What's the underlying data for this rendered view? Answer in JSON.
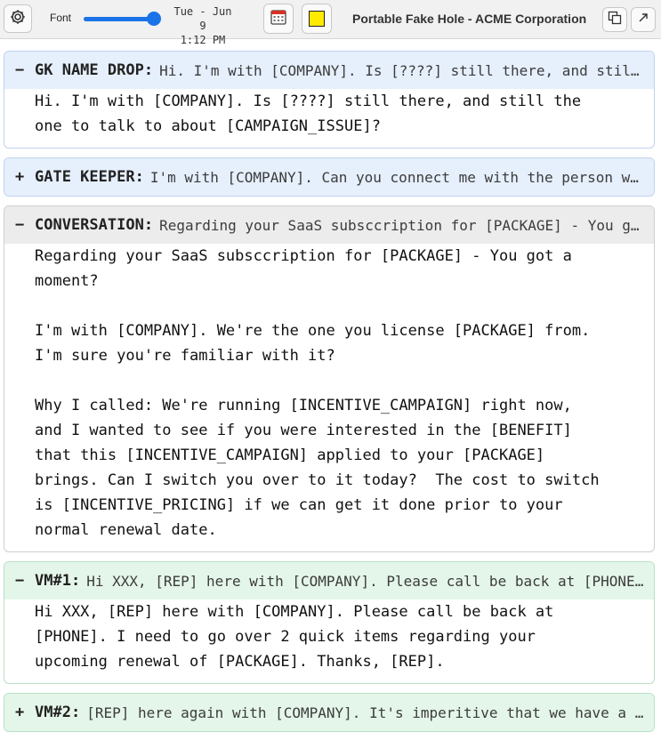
{
  "toolbar": {
    "font_label": "Font",
    "font_size_level": 0.92,
    "date": "Tue - Jun 9",
    "time": "1:12 PM",
    "highlight_color": "#ffea00",
    "title": "Portable Fake Hole - ACME Corporation",
    "icons": {
      "settings": "gear-icon",
      "calendar": "calendar-icon",
      "color": "color-swatch-icon",
      "copy": "copy-icon",
      "popout": "popout-arrow-icon"
    }
  },
  "colors": {
    "accent": "#1a73e8",
    "blue_card": "#e6effc",
    "gray_card": "#ececec",
    "green_card": "#e4f6e9"
  },
  "cards": [
    {
      "toggle": "−",
      "label": "GK NAME DROP:",
      "preview": "Hi. I'm with [COMPANY]. Is [????] still there, and still the one to talk to about [CAMPAIGN_ISSUE]?",
      "expanded": true,
      "body": "Hi. I'm with [COMPANY]. Is [????] still there, and still the\none to talk to about [CAMPAIGN_ISSUE]?"
    },
    {
      "toggle": "+",
      "label": "GATE KEEPER:",
      "preview": "I'm with [COMPANY]. Can you connect me with the person who handles [PACKAGE]?",
      "expanded": false,
      "body": ""
    },
    {
      "toggle": "−",
      "label": "CONVERSATION:",
      "preview": "Regarding your SaaS subsccription for [PACKAGE] - You got a moment?",
      "expanded": true,
      "body": "Regarding your SaaS subsccription for [PACKAGE] - You got a\nmoment?\n\nI'm with [COMPANY]. We're the one you license [PACKAGE] from.\nI'm sure you're familiar with it?\n\nWhy I called: We're running [INCENTIVE_CAMPAIGN] right now,\nand I wanted to see if you were interested in the [BENEFIT]\nthat this [INCENTIVE_CAMPAIGN] applied to your [PACKAGE]\nbrings. Can I switch you over to it today?  The cost to switch\nis [INCENTIVE_PRICING] if we can get it done prior to your\nnormal renewal date."
    },
    {
      "toggle": "−",
      "label": "VM#1:",
      "preview": "Hi XXX, [REP] here with [COMPANY]. Please call be back at [PHONE].",
      "expanded": true,
      "body": "Hi XXX, [REP] here with [COMPANY]. Please call be back at\n[PHONE]. I need to go over 2 quick items regarding your\nupcoming renewal of [PACKAGE]. Thanks, [REP]."
    },
    {
      "toggle": "+",
      "label": "VM#2:",
      "preview": "[REP] here again with [COMPANY]. It's imperitive that we have a quick chat.",
      "expanded": false,
      "body": ""
    }
  ]
}
